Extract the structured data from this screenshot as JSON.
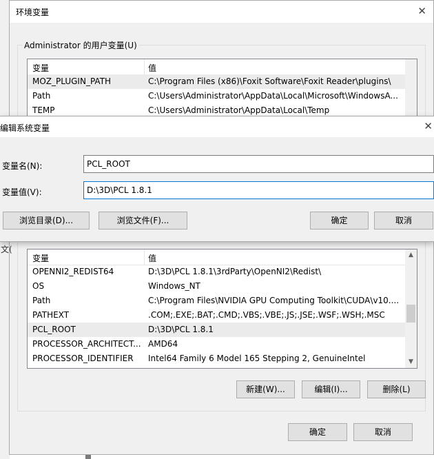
{
  "env_window": {
    "title": "环境变量",
    "user_vars": {
      "group_label": "Administrator 的用户变量(U)",
      "header": {
        "name": "变量",
        "value": "值"
      },
      "rows": [
        {
          "name": "MOZ_PLUGIN_PATH",
          "value": "C:\\Program Files (x86)\\Foxit Software\\Foxit Reader\\plugins\\",
          "selected": true
        },
        {
          "name": "Path",
          "value": "C:\\Users\\Administrator\\AppData\\Local\\Microsoft\\WindowsA...",
          "selected": false
        },
        {
          "name": "TEMP",
          "value": "C:\\Users\\Administrator\\AppData\\Local\\Temp",
          "selected": false
        }
      ]
    },
    "sys_vars": {
      "header": {
        "name": "变量",
        "value": "值"
      },
      "rows": [
        {
          "name": "OPENNI2_REDIST64",
          "value": "D:\\3D\\PCL 1.8.1\\3rdParty\\OpenNI2\\Redist\\",
          "selected": false
        },
        {
          "name": "OS",
          "value": "Windows_NT",
          "selected": false
        },
        {
          "name": "Path",
          "value": "C:\\Program Files\\NVIDIA GPU Computing Toolkit\\CUDA\\v10....",
          "selected": false
        },
        {
          "name": "PATHEXT",
          "value": ".COM;.EXE;.BAT;.CMD;.VBS;.VBE;.JS;.JSE;.WSF;.WSH;.MSC",
          "selected": false
        },
        {
          "name": "PCL_ROOT",
          "value": "D:\\3D\\PCL 1.8.1",
          "selected": true
        },
        {
          "name": "PROCESSOR_ARCHITECT...",
          "value": "AMD64",
          "selected": false
        },
        {
          "name": "PROCESSOR_IDENTIFIER",
          "value": "Intel64 Family 6 Model 165 Stepping 2, GenuineIntel",
          "selected": false
        }
      ],
      "buttons": {
        "new": "新建(W)...",
        "edit": "编辑(I)...",
        "delete": "删除(L)"
      }
    },
    "ok": "确定",
    "cancel": "取消",
    "partial_left_text": "文(",
    "partial_top_text": "~"
  },
  "edit_dialog": {
    "title": "编辑系统变量",
    "name_label": "变量名(N):",
    "name_value": "PCL_ROOT",
    "value_label": "变量值(V):",
    "value_value": "D:\\3D\\PCL 1.8.1",
    "browse_dir": "浏览目录(D)...",
    "browse_file": "浏览文件(F)...",
    "ok": "确定",
    "cancel": "取消"
  },
  "icons": {
    "close": "close-icon",
    "scroll_up": "chevron-up-icon",
    "scroll_down": "chevron-down-icon"
  }
}
